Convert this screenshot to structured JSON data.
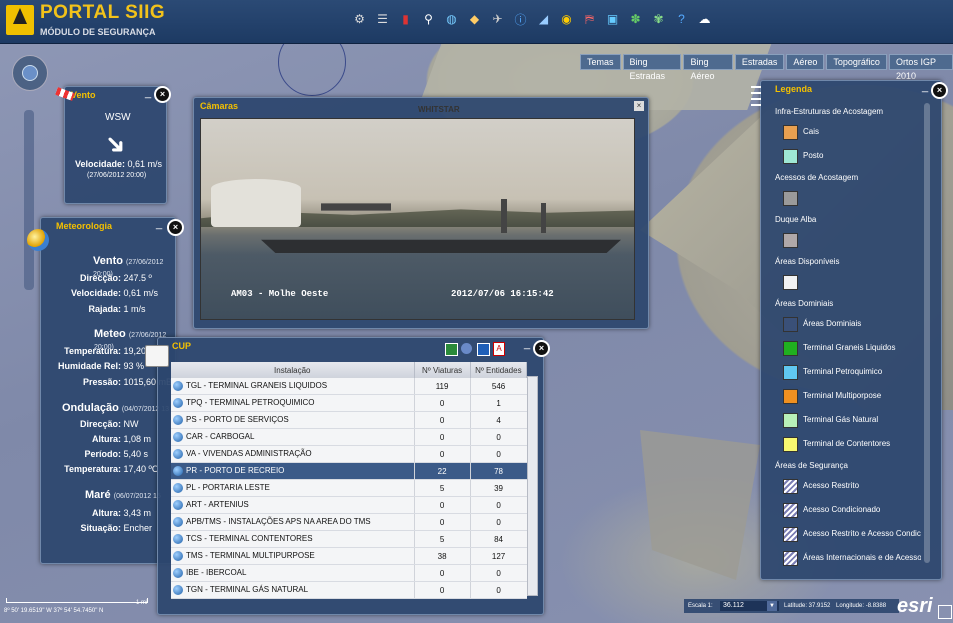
{
  "app": {
    "title": "PORTAL SIIG",
    "subtitle": "MÓDULO DE SEGURANÇA"
  },
  "toolbar": {
    "icons": [
      "binoculars-icon",
      "list-icon",
      "book-icon",
      "search-icon",
      "globe-icon",
      "layers-icon",
      "satellite-icon",
      "info-icon",
      "measure-icon",
      "target-icon",
      "windsock-icon",
      "screen-icon",
      "wheel-icon",
      "settings-icon",
      "help-icon",
      "cloud-icon"
    ]
  },
  "basemaps": [
    "Temas",
    "Bing Estradas",
    "Bing Aéreo",
    "Estradas",
    "Aéreo",
    "Topográfico",
    "Ortos IGP 2010"
  ],
  "vento": {
    "title": "Vento",
    "direction": "WSW",
    "speed_label": "Velocidade:",
    "speed_value": "0,61  m/s",
    "time": "(27/06/2012 20:00)"
  },
  "meteo": {
    "title": "Meteorologia",
    "vento": {
      "heading": "Vento",
      "time": "(27/06/2012 20:00)",
      "rows": [
        {
          "label": "Direcção:",
          "value": "247.5  º"
        },
        {
          "label": "Velocidade:",
          "value": "0,61  m/s"
        },
        {
          "label": "Rajada:",
          "value": "1  m/s"
        }
      ]
    },
    "meteo": {
      "heading": "Meteo",
      "time": "(27/06/2012 20:00)",
      "rows": [
        {
          "label": "Temperatura:",
          "value": "19,20  ºC"
        },
        {
          "label": "Humidade Rel:",
          "value": "93  %"
        },
        {
          "label": "Pressão:",
          "value": "1015,60  mB"
        }
      ]
    },
    "ondulacao": {
      "heading": "Ondulação",
      "time": "(04/07/2012 13",
      "rows": [
        {
          "label": "Direcção:",
          "value": "NW"
        },
        {
          "label": "Altura:",
          "value": "1,08  m"
        },
        {
          "label": "Período:",
          "value": "5,40  s"
        },
        {
          "label": "Temperatura:",
          "value": "17,40  ºC"
        }
      ]
    },
    "mare": {
      "heading": "Maré",
      "time": "(06/07/2012 15",
      "rows": [
        {
          "label": "Altura:",
          "value": "3,43  m"
        },
        {
          "label": "Situação:",
          "value": "Encher"
        }
      ]
    }
  },
  "camaras": {
    "title": "Câmaras",
    "camera_label": "AM03 - Molhe Oeste",
    "timestamp": "2012/07/06   16:15:42",
    "map_label": "WHITSTAR"
  },
  "cup": {
    "title": "CUP",
    "columns": [
      "Instalação",
      "Nº Viaturas",
      "Nº Entidades"
    ],
    "rows": [
      {
        "name": "TGL - TERMINAL GRANEIS LIQUIDOS",
        "viaturas": "119",
        "entidades": "546"
      },
      {
        "name": "TPQ - TERMINAL PETROQUIMICO",
        "viaturas": "0",
        "entidades": "1"
      },
      {
        "name": "PS - PORTO DE SERVIÇOS",
        "viaturas": "0",
        "entidades": "4"
      },
      {
        "name": "CAR - CARBOGAL",
        "viaturas": "0",
        "entidades": "0"
      },
      {
        "name": "VA - VIVENDAS ADMINISTRAÇÃO",
        "viaturas": "0",
        "entidades": "0"
      },
      {
        "name": "PR - PORTO DE RECREIO",
        "viaturas": "22",
        "entidades": "78"
      },
      {
        "name": "PL - PORTARIA LESTE",
        "viaturas": "5",
        "entidades": "39"
      },
      {
        "name": "ART - ARTENIUS",
        "viaturas": "0",
        "entidades": "0"
      },
      {
        "name": "APB/TMS - INSTALAÇÕES APS NA AREA DO TMS",
        "viaturas": "0",
        "entidades": "0"
      },
      {
        "name": "TCS - TERMINAL CONTENTORES",
        "viaturas": "5",
        "entidades": "84"
      },
      {
        "name": "TMS - TERMINAL MULTIPURPOSE",
        "viaturas": "38",
        "entidades": "127"
      },
      {
        "name": "IBE - IBERCOAL",
        "viaturas": "0",
        "entidades": "0"
      },
      {
        "name": "TGN - TERMINAL GÁS NATURAL",
        "viaturas": "0",
        "entidades": "0"
      }
    ],
    "selected_row": 5
  },
  "legenda": {
    "title": "Legenda",
    "items": [
      {
        "type": "section",
        "text": "Infra-Estruturas de Acostagem"
      },
      {
        "type": "item",
        "text": "Cais",
        "color": "#e8a050"
      },
      {
        "type": "item",
        "text": "Posto",
        "color": "#9fe8d4"
      },
      {
        "type": "section",
        "text": "Acessos de Acostagem"
      },
      {
        "type": "item",
        "text": "",
        "color": "#9a9a9a"
      },
      {
        "type": "section",
        "text": "Duque Alba"
      },
      {
        "type": "item",
        "text": "",
        "color": "#b0a8a8"
      },
      {
        "type": "section",
        "text": "Áreas Disponíveis"
      },
      {
        "type": "item",
        "text": "",
        "color": "#f2f2f2"
      },
      {
        "type": "section",
        "text": "Áreas Dominiais"
      },
      {
        "type": "item",
        "text": "Áreas Dominiais",
        "color": "#3a5078"
      },
      {
        "type": "item",
        "text": "Terminal Graneis Liquidos",
        "color": "#20b020"
      },
      {
        "type": "item",
        "text": "Terminal Petroquimico",
        "color": "#60c8f0"
      },
      {
        "type": "item",
        "text": "Terminal Multiporpose",
        "color": "#f09020"
      },
      {
        "type": "item",
        "text": "Terminal Gás Natural",
        "color": "#b8f0b8"
      },
      {
        "type": "item",
        "text": "Terminal de Contentores",
        "color": "#f8f870"
      },
      {
        "type": "section",
        "text": "Áreas de Segurança"
      },
      {
        "type": "hatch",
        "text": "Acesso Restrito",
        "color": "#d06060"
      },
      {
        "type": "hatch",
        "text": "Acesso Condicionado",
        "color": "#6060d0"
      },
      {
        "type": "hatch",
        "text": "Acesso Restrito e Acesso Condicic",
        "color": "#7070c0"
      },
      {
        "type": "hatch",
        "text": "Áreas Internacionais e de Acesso I",
        "color": "#606060"
      }
    ]
  },
  "status": {
    "scale_label": "Escala 1:",
    "scale_value": "36.112",
    "lat_label": "Latitude: 37.9152",
    "lon_label": "Longitude: -8.8388"
  },
  "coords": "8º 50' 19.6519\" W  37º 54' 54.7450\" N",
  "scale_bar": "1 mi",
  "brand": "esri"
}
